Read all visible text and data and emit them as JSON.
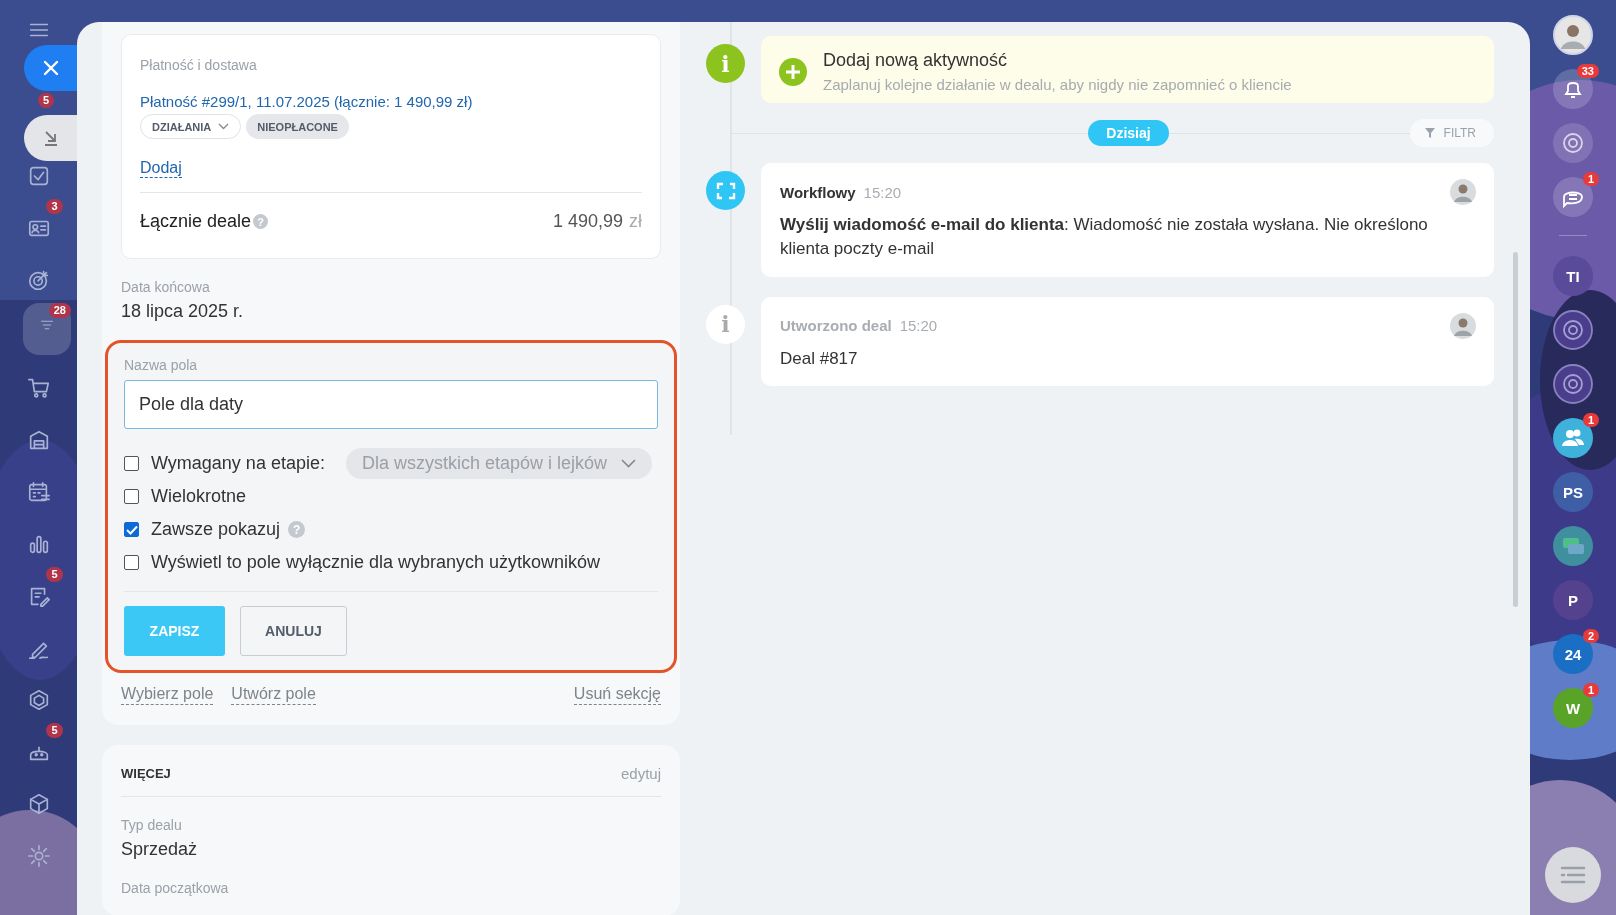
{
  "left_nav": [
    {
      "kind": "menu"
    },
    {
      "kind": "close"
    },
    {
      "kind": "minimize",
      "badge": "5"
    },
    {
      "kind": "tasks",
      "selected": false
    },
    {
      "kind": "contacts",
      "badge": "3",
      "selected": false
    },
    {
      "kind": "target",
      "selected": false
    },
    {
      "kind": "funnel",
      "badge": "28",
      "selected": true
    },
    {
      "kind": "cart",
      "selected": false
    },
    {
      "kind": "store",
      "selected": false
    },
    {
      "kind": "calendar",
      "selected": false
    },
    {
      "kind": "chart",
      "selected": false
    },
    {
      "kind": "document",
      "badge": "5",
      "selected": false
    },
    {
      "kind": "pen",
      "selected": false
    },
    {
      "kind": "hexagon",
      "selected": false
    },
    {
      "kind": "robot",
      "badge": "5",
      "selected": false
    },
    {
      "kind": "box",
      "selected": false
    },
    {
      "kind": "gear",
      "selected": false
    }
  ],
  "payment": {
    "title": "Płatność i dostawa",
    "link": "Płatność #299/1, 11.07.2025 (łącznie: 1 490,99 zł)",
    "actions": "DZIAŁANIA",
    "status": "NIEOPŁACONE",
    "add": "Dodaj",
    "total_label": "Łącznie deale",
    "help": "?",
    "total_value": "1 490,99",
    "currency": "zł"
  },
  "fields": [
    {
      "label": "Data końcowa",
      "value": "18 lipca 2025 r."
    }
  ],
  "field_form": {
    "label": "Nazwa pola",
    "value": "Pole dla daty",
    "highlighted": true,
    "options": [
      {
        "label": "Wymagany na etapie:",
        "checked": false,
        "select": "Dla wszystkich etapów i lejków"
      },
      {
        "label": "Wielokrotne",
        "checked": false
      },
      {
        "label": "Zawsze pokazuj",
        "checked": true,
        "help": "?"
      },
      {
        "label": "Wyświetl to pole wyłącznie dla wybranych użytkowników",
        "checked": false
      }
    ],
    "buttons": [
      {
        "label": "ZAPISZ",
        "kind": "primary"
      },
      {
        "label": "ANULUJ",
        "kind": "secondary"
      }
    ]
  },
  "section_links": [
    "Wybierz pole",
    "Utwórz pole",
    "Usuń sekcję"
  ],
  "more": {
    "title": "WIĘCEJ",
    "edit": "edytuj",
    "fields": [
      {
        "label": "Typ dealu",
        "value": "Sprzedaż"
      },
      {
        "label": "Data początkowa"
      }
    ]
  },
  "timeline": {
    "add_activity": {
      "icon": "i",
      "title": "Dodaj nową aktywność",
      "hint": "Zaplanuj kolejne działanie w dealu, aby nigdy nie zapomnieć o kliencie"
    },
    "day": "Dzisiaj",
    "filter": "FILTR",
    "events": [
      {
        "kind": "workflow",
        "title": "Workflowy",
        "time": "15:20",
        "text": "**Wyślij wiadomość e-mail do klienta**: Wiadomość nie została wysłana. Nie określono klienta poczty e-mail"
      },
      {
        "kind": "created",
        "icon": "i",
        "title": "Utworzono deal",
        "time": "15:20",
        "text": "Deal #817"
      }
    ]
  },
  "right_bar": [
    {
      "kind": "avatar"
    },
    {
      "kind": "bell",
      "badge": "33"
    },
    {
      "kind": "spiral"
    },
    {
      "kind": "chat-swap",
      "badge": "1"
    },
    {
      "kind": "divider"
    },
    {
      "kind": "initials",
      "text": "TI",
      "color": "#5a4a9a"
    },
    {
      "kind": "spiral-dark"
    },
    {
      "kind": "spiral-dark"
    },
    {
      "kind": "group",
      "badge": "1"
    },
    {
      "kind": "initials",
      "text": "PS",
      "color": "#3e5fa6"
    },
    {
      "kind": "chat-green"
    },
    {
      "kind": "initials",
      "text": "P",
      "color": "#54428f"
    },
    {
      "kind": "initials",
      "text": "24",
      "color": "#1a6fc4",
      "badge": "2"
    },
    {
      "kind": "initials",
      "text": "W",
      "color": "#5aa329",
      "badge": "1"
    }
  ]
}
